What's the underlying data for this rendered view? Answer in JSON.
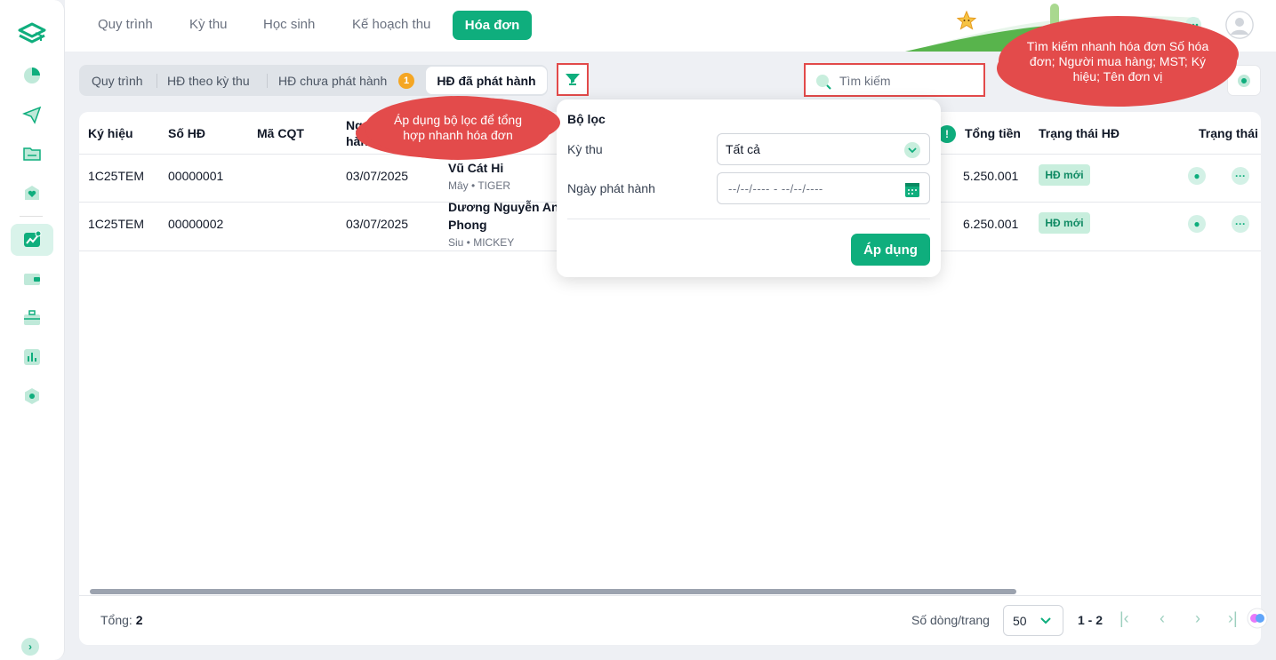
{
  "nav": {
    "tabs": [
      "Quy trình",
      "Kỳ thu",
      "Học sinh",
      "Kế hoạch thu"
    ],
    "active": "Hóa đơn"
  },
  "subtabs": {
    "items": [
      "Quy trình",
      "HĐ theo kỳ thu",
      "HĐ chưa phát hành"
    ],
    "badge": "1",
    "active": "HĐ đã phát hành"
  },
  "search": {
    "placeholder": "Tìm kiếm"
  },
  "table": {
    "headers": [
      "Ký hiệu",
      "Số HĐ",
      "Mã CQT",
      "Ng",
      "hàn",
      "Tổng tiền",
      "Trạng thái HĐ",
      "Trạng thái"
    ],
    "rows": [
      {
        "ky_hieu": "1C25TEM",
        "so_hd": "00000001",
        "ngay": "03/07/2025",
        "nguoi": "Vũ Cát Hi",
        "nguoi2": "",
        "sub": "Mây • TIGER",
        "tong": "5.250.001",
        "status": "HĐ mới"
      },
      {
        "ky_hieu": "1C25TEM",
        "so_hd": "00000002",
        "ngay": "03/07/2025",
        "nguoi": "Dương Nguyễn An",
        "nguoi2": "Phong",
        "sub": "Siu • MICKEY",
        "tong": "6.250.001",
        "status": "HĐ mới"
      }
    ]
  },
  "footer": {
    "total_label": "Tổng:",
    "total_value": "2",
    "rows_label": "Số dòng/trang",
    "rows_value": "50",
    "range": "1 - 2"
  },
  "filter": {
    "title": "Bộ lọc",
    "ky_thu_label": "Kỳ thu",
    "ky_thu_value": "Tất cả",
    "ngay_label": "Ngày phát hành",
    "ngay_placeholder": "--/--/---- - --/--/----",
    "apply": "Áp dụng"
  },
  "callouts": {
    "filter": "Áp dụng bộ lọc để tổng hợp nhanh hóa đơn",
    "search": "Tìm kiếm nhanh hóa đơn Số hóa đơn; Người mua hàng; MST; Ký hiệu; Tên đơn vị"
  },
  "colors": {
    "accent": "#0fae7d",
    "highlight": "#e24a4a",
    "badge": "#f5a623"
  }
}
